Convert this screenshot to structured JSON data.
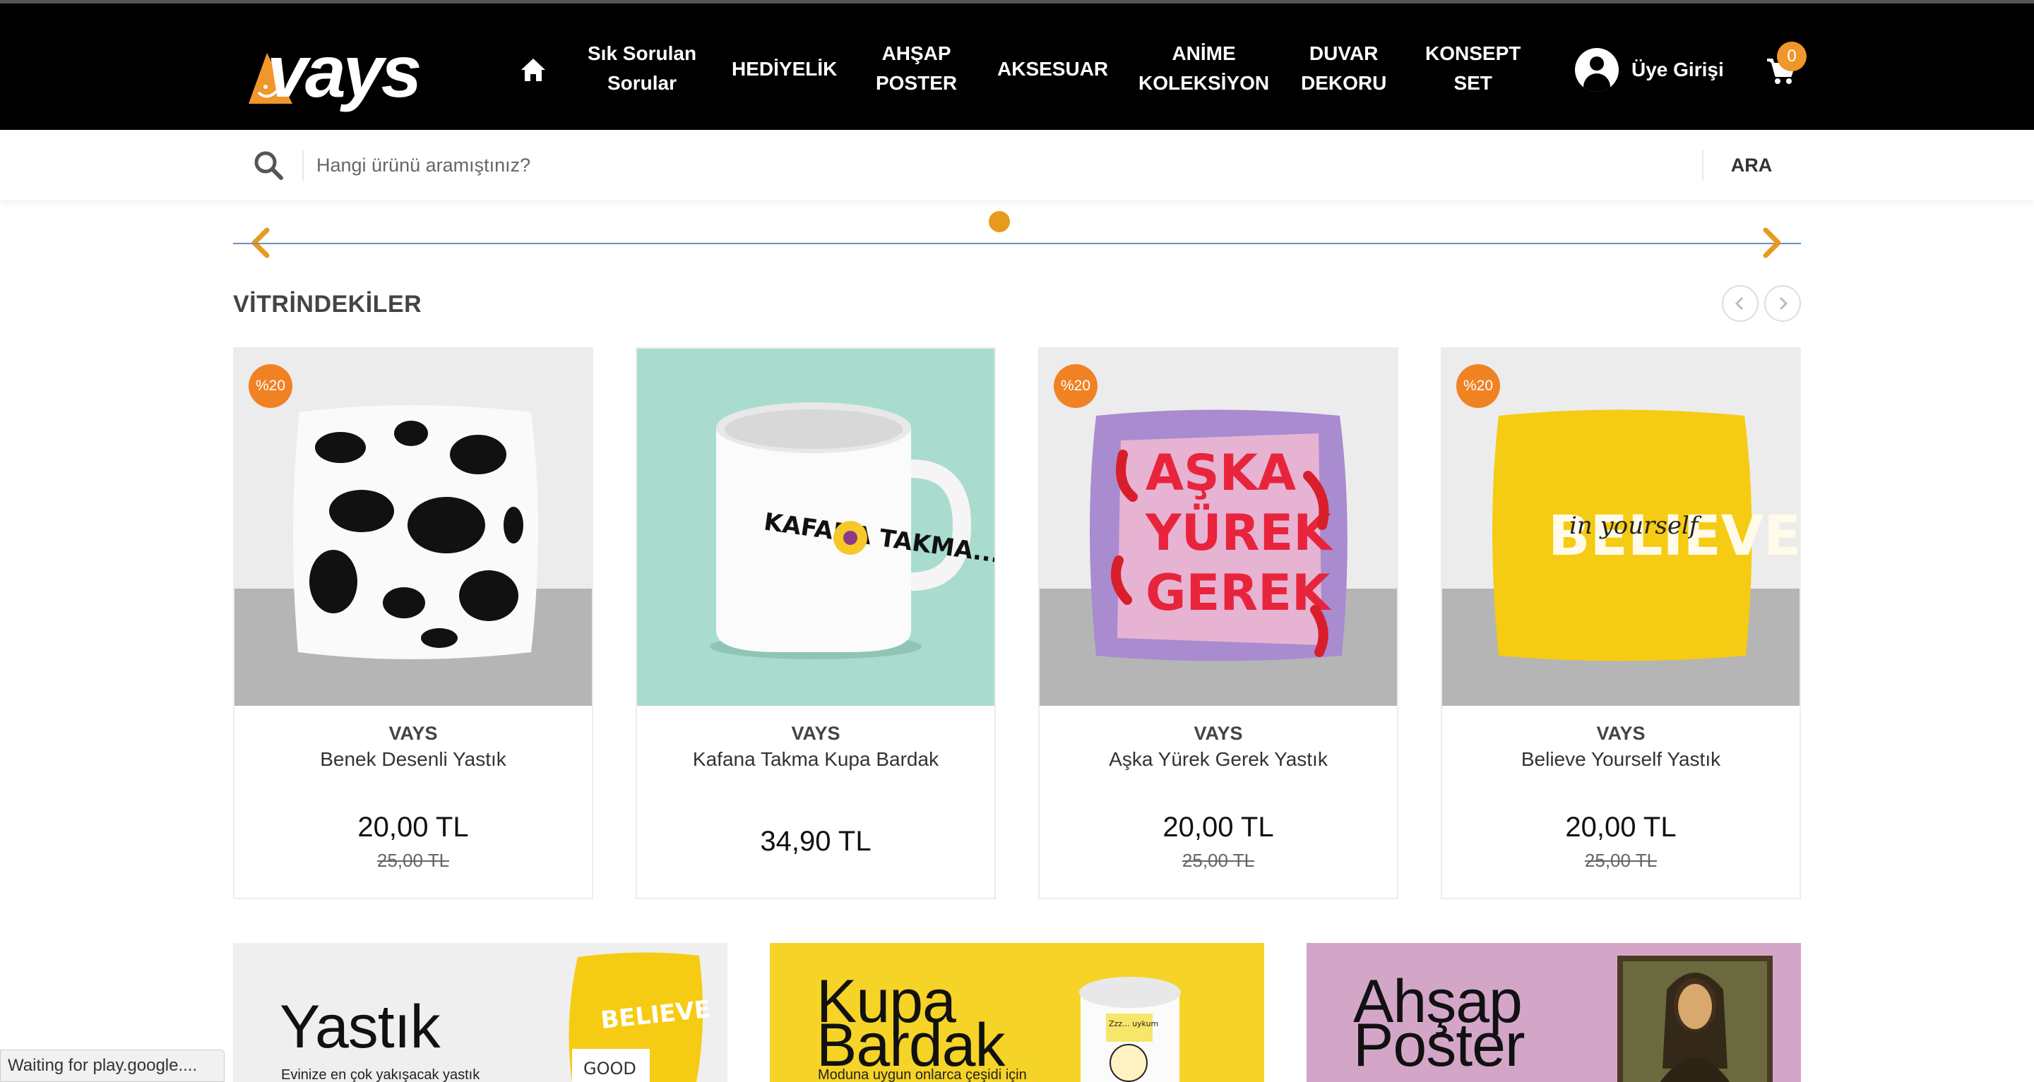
{
  "header": {
    "logo_text": "vays",
    "nav": [
      {
        "label_line1": "Sık Sorulan",
        "label_line2": "Sorular"
      },
      {
        "label_line1": "HEDİYELİK",
        "label_line2": ""
      },
      {
        "label_line1": "AHŞAP",
        "label_line2": "POSTER"
      },
      {
        "label_line1": "AKSESUAR",
        "label_line2": ""
      },
      {
        "label_line1": "ANİME",
        "label_line2": "KOLEKSİYON"
      },
      {
        "label_line1": "DUVAR",
        "label_line2": "DEKORU"
      },
      {
        "label_line1": "KONSEPT",
        "label_line2": "SET"
      }
    ],
    "user_login_label": "Üye Girişi",
    "cart_count": "0"
  },
  "search": {
    "placeholder": "Hangi ürünü aramıştınız?",
    "value": "",
    "button_label": "ARA"
  },
  "showcase": {
    "title": "VİTRİNDEKİLER",
    "products": [
      {
        "badge": "%20",
        "brand": "VAYS",
        "name": "Benek Desenli Yastık",
        "price": "20,00 TL",
        "old_price": "25,00 TL",
        "image": "cow-pattern-pillow"
      },
      {
        "badge": "",
        "brand": "VAYS",
        "name": "Kafana Takma Kupa Bardak",
        "price": "34,90 TL",
        "old_price": "",
        "image": "kafana-takma-mug",
        "image_text": "KAFANA TAKMA..."
      },
      {
        "badge": "%20",
        "brand": "VAYS",
        "name": "Aşka Yürek Gerek Yastık",
        "price": "20,00 TL",
        "old_price": "25,00 TL",
        "image": "aska-yurek-gerek-pillow",
        "image_text_lines": [
          "AŞKA",
          "YÜREK",
          "GEREK"
        ]
      },
      {
        "badge": "%20",
        "brand": "VAYS",
        "name": "Believe Yourself Yastık",
        "price": "20,00 TL",
        "old_price": "25,00 TL",
        "image": "believe-pillow",
        "image_text": "BELIEVE",
        "image_script": "in yourself"
      }
    ]
  },
  "banners": [
    {
      "title_line1": "Yastık",
      "title_line2": "",
      "subtitle": "Evinize en çok yakışacak yastık",
      "bg": "#efefef",
      "image_text": "BELIEVE",
      "image_text2": "GOOD"
    },
    {
      "title_line1": "Kupa",
      "title_line2": "Bardak",
      "subtitle": "Moduna uygun onlarca çeşidi için",
      "bg": "#f5d327",
      "image_text": "Zzz... uykum"
    },
    {
      "title_line1": "Ahşap",
      "title_line2": "Poster",
      "subtitle": "",
      "bg": "#d3a6c8"
    }
  ],
  "status_bar": "Waiting for play.google....",
  "colors": {
    "accent": "#f08224",
    "slider_dot": "#e89a1e",
    "header_bg": "#000000"
  }
}
